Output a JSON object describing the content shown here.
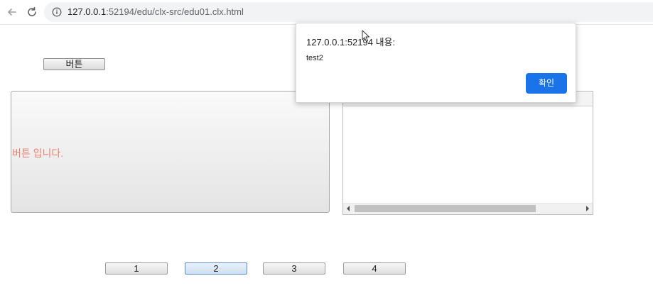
{
  "browser": {
    "url_host": "127.0.0.1",
    "url_rest": ":52194/edu/clx-src/edu01.clx.html",
    "icons": {
      "back": "arrow-left-icon",
      "reload": "reload-icon",
      "info": "info-icon"
    }
  },
  "page": {
    "top_button_label": "버튼",
    "left_panel_text": "버튼 입니다.",
    "left_panel_text_color": "#e8806f",
    "number_buttons": [
      "1",
      "2",
      "3",
      "4"
    ],
    "selected_number_button": "2"
  },
  "dialog": {
    "title": "127.0.0.1:52194 내용:",
    "message": "test2",
    "ok_label": "확인",
    "ok_color": "#1a73e8"
  }
}
